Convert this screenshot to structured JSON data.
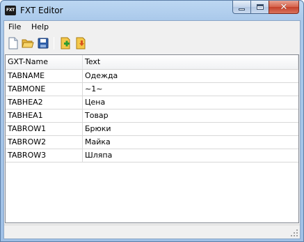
{
  "window": {
    "title": "FXT Editor",
    "app_icon_text": "FXT",
    "min_icon": "minimize-icon",
    "max_icon": "maximize-icon",
    "close_icon": "close-icon",
    "close_color": "#c4402a"
  },
  "menu": {
    "items": [
      "File",
      "Help"
    ]
  },
  "toolbar": {
    "buttons": [
      {
        "name": "new-file-icon"
      },
      {
        "name": "open-folder-icon"
      },
      {
        "name": "save-disk-icon"
      },
      {
        "name": "add-entry-icon"
      },
      {
        "name": "remove-entry-icon"
      }
    ]
  },
  "grid": {
    "columns": [
      "GXT-Name",
      "Text"
    ],
    "rows": [
      [
        "TABNAME",
        "Одежда"
      ],
      [
        "TABMONE",
        "~1~"
      ],
      [
        "TABHEA2",
        "Цена"
      ],
      [
        "TABHEA1",
        "Товар"
      ],
      [
        "TABROW1",
        "Брюки"
      ],
      [
        "TABROW2",
        "Майка"
      ],
      [
        "TABROW3",
        "Шляпа"
      ]
    ]
  }
}
